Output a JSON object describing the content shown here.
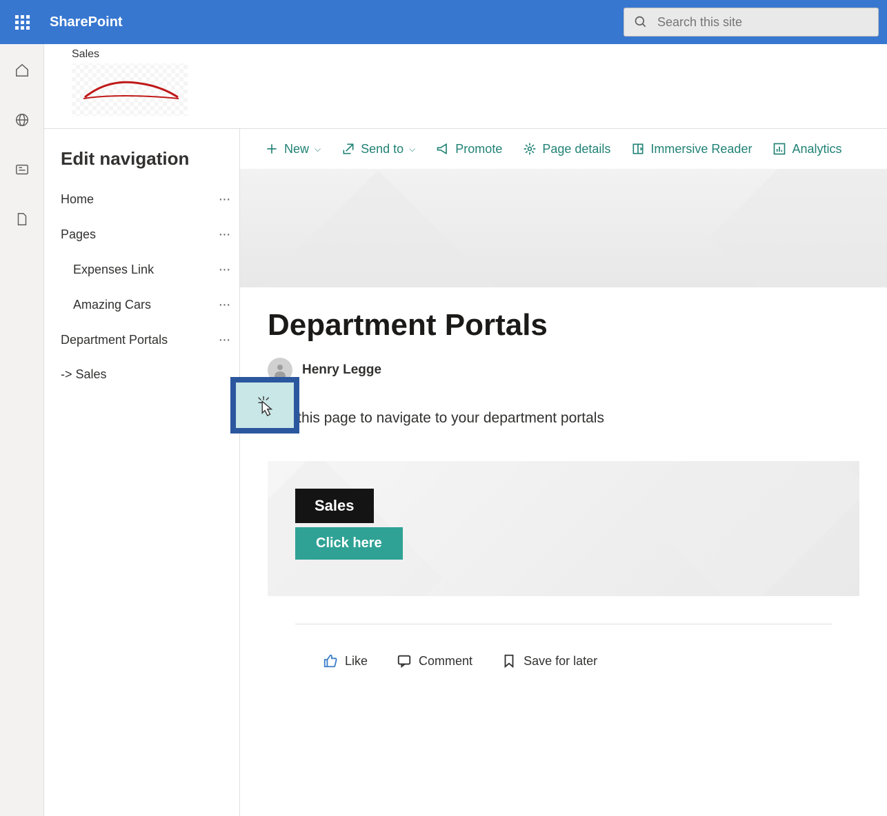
{
  "header": {
    "app_name": "SharePoint",
    "search_placeholder": "Search this site"
  },
  "site": {
    "label": "Sales"
  },
  "editnav": {
    "title": "Edit navigation",
    "items": [
      {
        "label": "Home",
        "sub": false
      },
      {
        "label": "Pages",
        "sub": false
      },
      {
        "label": "Expenses Link",
        "sub": true
      },
      {
        "label": "Amazing Cars",
        "sub": true
      },
      {
        "label": "Department Portals",
        "sub": false
      },
      {
        "label": "-> Sales",
        "sub": false,
        "dragged": true
      }
    ]
  },
  "cmdbar": {
    "new": "New",
    "sendto": "Send to",
    "promote": "Promote",
    "page_details": "Page details",
    "immersive": "Immersive Reader",
    "analytics": "Analytics"
  },
  "page": {
    "title": "Department Portals",
    "author": "Henry Legge",
    "intro": "Use this page to navigate to your department portals",
    "tile_label": "Sales",
    "tile_button": "Click here"
  },
  "footer": {
    "like": "Like",
    "comment": "Comment",
    "save": "Save for later"
  }
}
